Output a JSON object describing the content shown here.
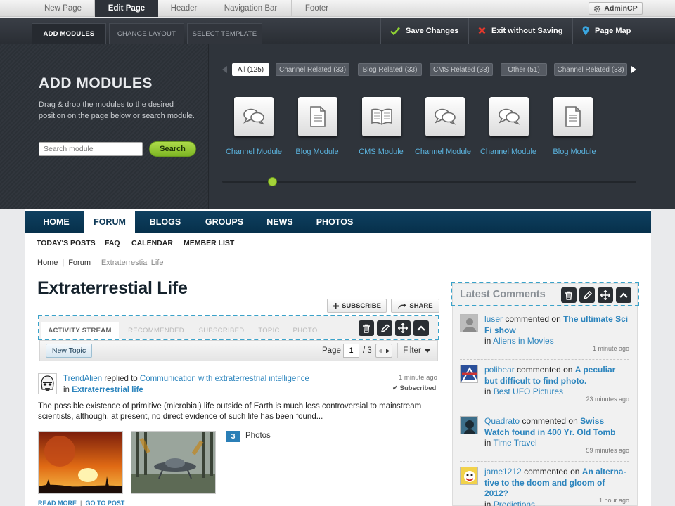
{
  "top_tabs": [
    "New Page",
    "Edit Page",
    "Header",
    "Navigation Bar",
    "Footer"
  ],
  "admin_button": "AdminCP",
  "sub_tabs": [
    "ADD MODULES",
    "CHANGE LAYOUT",
    "SELECT TEMPLATE"
  ],
  "actions": {
    "save": "Save Changes",
    "exit": "Exit without Saving",
    "pagemap": "Page Map"
  },
  "add_modules": {
    "title": "ADD MODULES",
    "description": "Drag & drop the modules to the desired position on the page below or search module.",
    "search_placeholder": "Search module",
    "search_button": "Search"
  },
  "filters": [
    "All (125)",
    "Channel Related (33)",
    "Blog Related (33)",
    "CMS Related (33)",
    "Other (51)",
    "Channel Related (33)"
  ],
  "modules": [
    {
      "label": "Channel Module",
      "icon": "chat-bubbles-icon"
    },
    {
      "label": "Blog Module",
      "icon": "document-icon"
    },
    {
      "label": "CMS Module",
      "icon": "open-book-icon"
    },
    {
      "label": "Channel Module",
      "icon": "chat-bubbles-icon"
    },
    {
      "label": "Channel Module",
      "icon": "chat-bubbles-icon"
    },
    {
      "label": "Blog Module",
      "icon": "document-icon"
    }
  ],
  "main_nav": [
    "HOME",
    "FORUM",
    "BLOGS",
    "GROUPS",
    "NEWS",
    "PHOTOS"
  ],
  "sub_nav": [
    "TODAY'S POSTS",
    "FAQ",
    "CALENDAR",
    "MEMBER LIST"
  ],
  "breadcrumb": [
    "Home",
    "Forum",
    "Extraterrestial Life"
  ],
  "page_title": "Extraterrestial Life",
  "subscribe_label": "SUBSCRIBE",
  "share_label": "SHARE",
  "stream_tabs": [
    "ACTIVITY STREAM",
    "RECOMMENDED",
    "SUBSCRIBED",
    "TOPIC",
    "PHOTO"
  ],
  "new_topic": "New Topic",
  "pager": {
    "label": "Page",
    "current": "1",
    "total": "/ 3",
    "filter": "Filter"
  },
  "post": {
    "user": "TrendAlien",
    "action": "replied to",
    "topic": "Communication with extraterrestrial intelligence",
    "in_word": "in",
    "forum": "Extraterrestrial life",
    "time": "1 minute ago",
    "status": "Subscribed",
    "body": "The possible existence of primitive (microbial) life outside of Earth is much less controversial to mainstream scientists, although, at present, no direct evidence of such life has been found...",
    "photo_count": "3",
    "photos_label": "Photos",
    "read_more": "READ MORE",
    "go_to_post": "GO TO POST"
  },
  "sidebar": {
    "title": "Latest Comments",
    "comments": [
      {
        "user": "luser",
        "action": "commented on",
        "topic": "The ultimate Sci Fi show",
        "in_word": "in",
        "where": "Aliens in Movies",
        "time": "1 minute ago"
      },
      {
        "user": "polibear",
        "action": "commented on",
        "topic": "A peculiar but difficult to find photo.",
        "in_word": "in",
        "where": "Best UFO Pictures",
        "time": "23 minutes ago"
      },
      {
        "user": "Quadrato",
        "action": "commented on",
        "topic": "Swiss Watch found in 400 Yr. Old Tomb",
        "in_word": "in",
        "where": "Time Travel",
        "time": "59 minutes ago"
      },
      {
        "user": "jame1212",
        "action": "commented on",
        "topic": "An alterna-tive to the doom and gloom of 2012?",
        "in_word": "in",
        "where": "Predictions",
        "time": "1 hour ago"
      }
    ]
  },
  "colors": {
    "accent_blue": "#2b84bd",
    "nav_dark": "#0f4060",
    "green": "#9ccd36",
    "editor_bg": "#2f343b"
  }
}
